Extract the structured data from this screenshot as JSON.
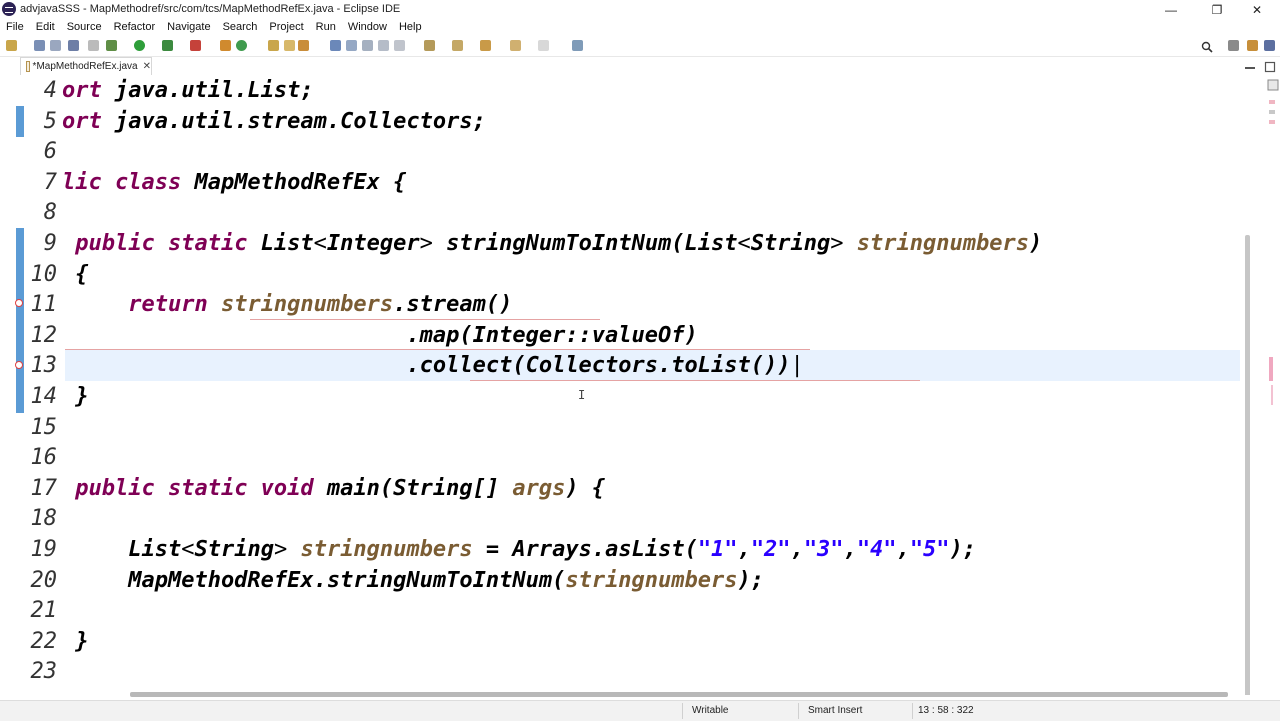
{
  "window": {
    "title": "advjavaSSS - MapMethodref/src/com/tcs/MapMethodRefEx.java - Eclipse IDE",
    "controls": [
      "—",
      "❐",
      "✕"
    ]
  },
  "menu": [
    "File",
    "Edit",
    "Source",
    "Refactor",
    "Navigate",
    "Search",
    "Project",
    "Run",
    "Window",
    "Help"
  ],
  "editor_tab": {
    "label": "*MapMethodRefEx.java",
    "close": "✕"
  },
  "code_lines": [
    {
      "num": "4",
      "tokens": [
        [
          "kw",
          "ort "
        ],
        [
          "plain",
          "java.util.List;"
        ]
      ]
    },
    {
      "num": "5",
      "tokens": [
        [
          "kw",
          "ort "
        ],
        [
          "plain",
          "java.util.stream.Collectors;"
        ]
      ]
    },
    {
      "num": "6",
      "tokens": []
    },
    {
      "num": "7",
      "tokens": [
        [
          "kw",
          "lic class "
        ],
        [
          "plain",
          "MapMethodRefEx {"
        ]
      ]
    },
    {
      "num": "8",
      "tokens": []
    },
    {
      "num": "9",
      "tokens": [
        [
          "plain",
          " "
        ],
        [
          "kw",
          "public static "
        ],
        [
          "plain",
          "List"
        ],
        [
          "lt",
          "<"
        ],
        [
          "plain",
          "Integer"
        ],
        [
          "lt",
          ">"
        ],
        [
          "plain",
          " stringNumToIntNum(List"
        ],
        [
          "lt",
          "<"
        ],
        [
          "plain",
          "String"
        ],
        [
          "lt",
          ">"
        ],
        [
          "plain",
          " "
        ],
        [
          "param",
          "stringnumbers"
        ],
        [
          "plain",
          ")"
        ]
      ]
    },
    {
      "num": "10",
      "tokens": [
        [
          "plain",
          " {"
        ]
      ]
    },
    {
      "num": "11",
      "tokens": [
        [
          "plain",
          "     "
        ],
        [
          "kw",
          "return "
        ],
        [
          "param",
          "stringnumbers"
        ],
        [
          "plain",
          ".stream()"
        ]
      ]
    },
    {
      "num": "12",
      "tokens": [
        [
          "plain",
          "                          .map(Integer::valueOf)"
        ]
      ]
    },
    {
      "num": "13",
      "tokens": [
        [
          "plain",
          "                          .collect(Collectors.toList())"
        ],
        [
          "caret",
          "|"
        ]
      ]
    },
    {
      "num": "14",
      "tokens": [
        [
          "plain",
          " }"
        ]
      ]
    },
    {
      "num": "15",
      "tokens": []
    },
    {
      "num": "16",
      "tokens": []
    },
    {
      "num": "17",
      "tokens": [
        [
          "plain",
          " "
        ],
        [
          "kw",
          "public static void "
        ],
        [
          "plain",
          "main(String[] "
        ],
        [
          "param",
          "args"
        ],
        [
          "plain",
          ") {"
        ]
      ]
    },
    {
      "num": "18",
      "tokens": []
    },
    {
      "num": "19",
      "tokens": [
        [
          "plain",
          "     List"
        ],
        [
          "lt",
          "<"
        ],
        [
          "plain",
          "String"
        ],
        [
          "lt",
          ">"
        ],
        [
          "plain",
          " "
        ],
        [
          "param",
          "stringnumbers"
        ],
        [
          "plain",
          " = Arrays.asList("
        ],
        [
          "str",
          "\"1\""
        ],
        [
          "plain",
          ","
        ],
        [
          "str",
          "\"2\""
        ],
        [
          "plain",
          ","
        ],
        [
          "str",
          "\"3\""
        ],
        [
          "plain",
          ","
        ],
        [
          "str",
          "\"4\""
        ],
        [
          "plain",
          ","
        ],
        [
          "str",
          "\"5\""
        ],
        [
          "plain",
          ");"
        ]
      ]
    },
    {
      "num": "20",
      "tokens": [
        [
          "plain",
          "     MapMethodRefEx.stringNumToIntNum("
        ],
        [
          "param",
          "stringnumbers"
        ],
        [
          "plain",
          ");"
        ]
      ]
    },
    {
      "num": "21",
      "tokens": []
    },
    {
      "num": "22",
      "tokens": [
        [
          "plain",
          " }"
        ]
      ]
    },
    {
      "num": "23",
      "tokens": []
    }
  ],
  "status_bar": {
    "write_mode": "Writable",
    "insert_mode": "Smart Insert",
    "position": "13 : 58 : 322"
  },
  "colors": {
    "keyword": "#7f0055",
    "parameter": "#7a5c33",
    "string": "#2a00ff",
    "current_line": "#e8f2fe",
    "ruler": "#5b9bd5",
    "error": "#e04040"
  }
}
